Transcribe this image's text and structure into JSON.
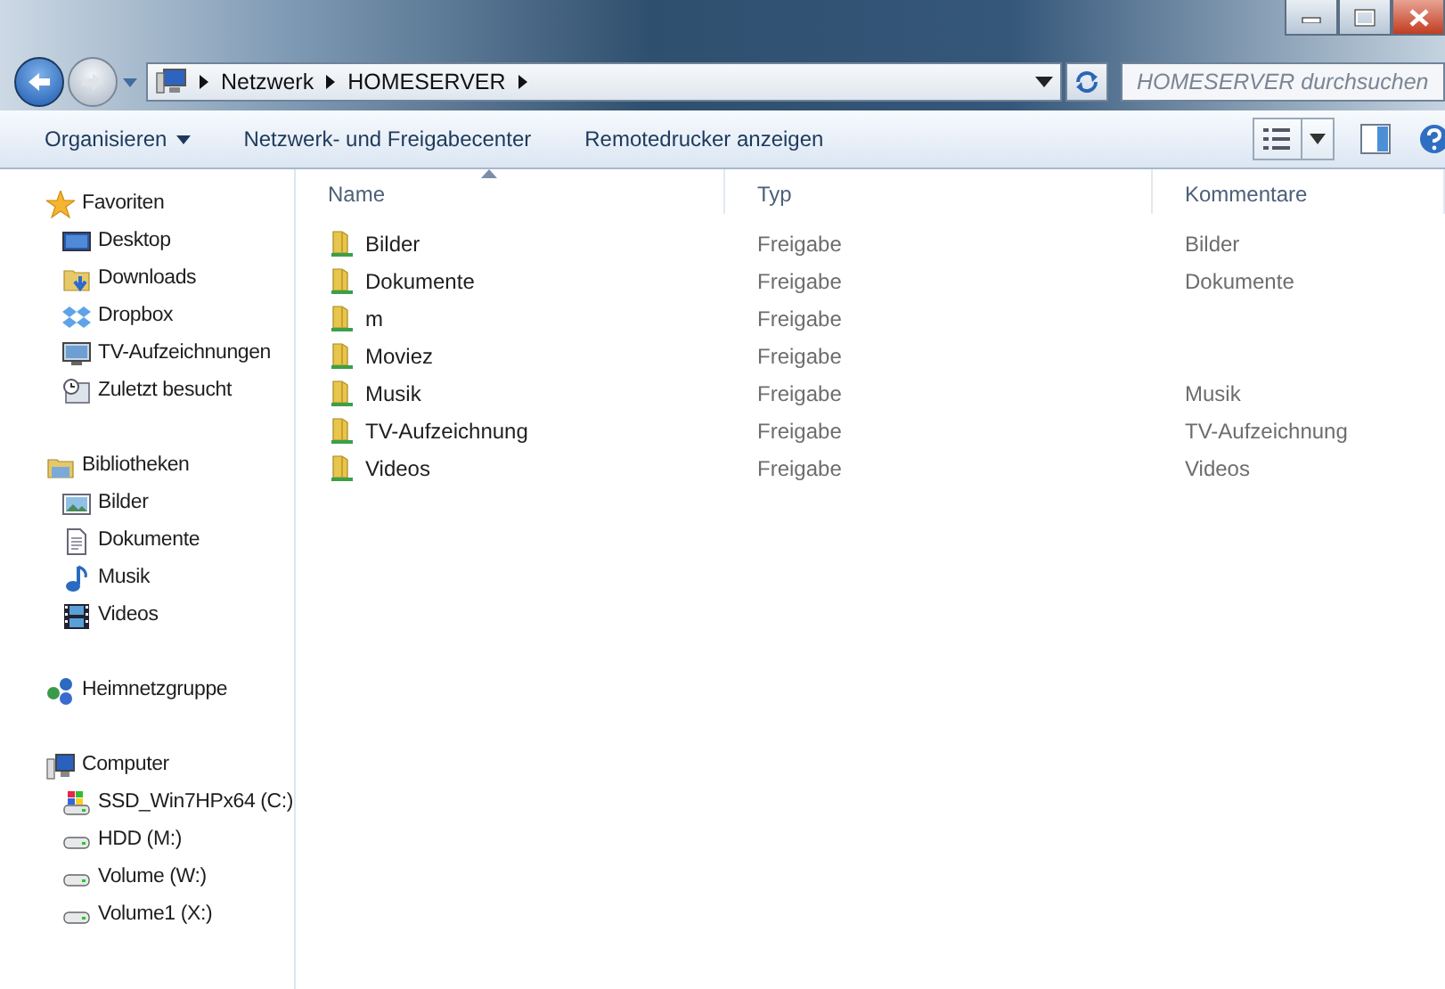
{
  "address": {
    "breadcrumbs": [
      "Netzwerk",
      "HOMESERVER"
    ]
  },
  "search": {
    "placeholder": "HOMESERVER durchsuchen"
  },
  "toolbar": [
    {
      "label": "Organisieren",
      "kind": "menu"
    },
    {
      "label": "Netzwerk- und Freigabecenter",
      "kind": "button"
    },
    {
      "label": "Remotedrucker anzeigen",
      "kind": "button"
    }
  ],
  "sidebar": {
    "groups": [
      {
        "label": "Favoriten",
        "kind": "star",
        "children": [
          {
            "label": "Desktop",
            "kind": "desktop"
          },
          {
            "label": "Downloads",
            "kind": "download"
          },
          {
            "label": "Dropbox",
            "kind": "dropbox"
          },
          {
            "label": "TV-Aufzeichnungen",
            "kind": "monitor"
          },
          {
            "label": "Zuletzt besucht",
            "kind": "recent"
          }
        ]
      },
      {
        "label": "Bibliotheken",
        "kind": "library",
        "children": [
          {
            "label": "Bilder",
            "kind": "picture"
          },
          {
            "label": "Dokumente",
            "kind": "document"
          },
          {
            "label": "Musik",
            "kind": "music"
          },
          {
            "label": "Videos",
            "kind": "video"
          }
        ]
      },
      {
        "label": "Heimnetzgruppe",
        "kind": "homegroup"
      },
      {
        "label": "Computer",
        "kind": "computer",
        "children": [
          {
            "label": "SSD_Win7HPx64 (C:)",
            "kind": "systemdrive"
          },
          {
            "label": "HDD (M:)",
            "kind": "drive"
          },
          {
            "label": "Volume (W:)",
            "kind": "drive"
          },
          {
            "label": "Volume1 (X:)",
            "kind": "drive"
          }
        ]
      }
    ]
  },
  "table": {
    "columns": [
      {
        "label": "Name",
        "sorted": true
      },
      {
        "label": "Typ",
        "sorted": false
      },
      {
        "label": "Kommentare",
        "sorted": false
      }
    ],
    "rows": [
      {
        "name": "Bilder",
        "type": "Freigabe",
        "comment": "Bilder"
      },
      {
        "name": "Dokumente",
        "type": "Freigabe",
        "comment": "Dokumente"
      },
      {
        "name": "m",
        "type": "Freigabe"
      },
      {
        "name": "Moviez",
        "type": "Freigabe"
      },
      {
        "name": "Musik",
        "type": "Freigabe",
        "comment": "Musik"
      },
      {
        "name": "TV-Aufzeichnung",
        "type": "Freigabe",
        "comment": "TV-Aufzeichnung"
      },
      {
        "name": "Videos",
        "type": "Freigabe",
        "comment": "Videos"
      }
    ]
  }
}
